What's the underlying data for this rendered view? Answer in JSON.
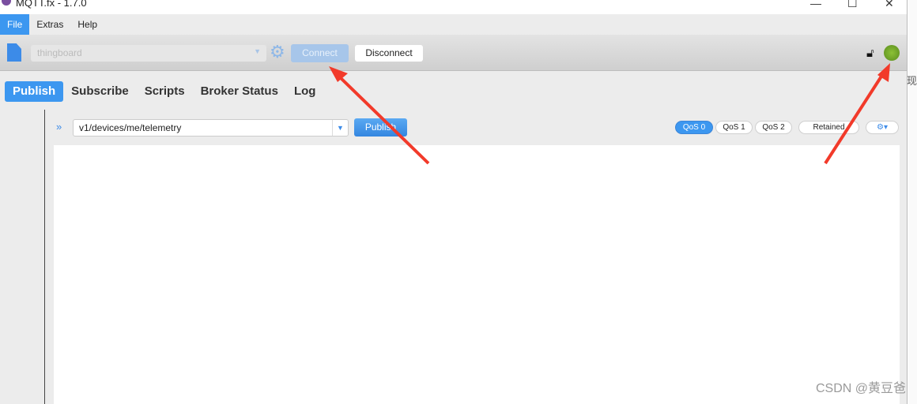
{
  "window": {
    "title": "MQTT.fx - 1.7.0",
    "controls": {
      "minimize": "—",
      "maximize": "☐",
      "close": "✕"
    }
  },
  "menu": [
    {
      "label": "File",
      "active": true
    },
    {
      "label": "Extras"
    },
    {
      "label": "Help"
    }
  ],
  "toolbar": {
    "profile": "thingboard",
    "connect_label": "Connect",
    "disconnect_label": "Disconnect",
    "lock_icon": "unlock-icon",
    "status_color": "#7ab02c"
  },
  "tabs": [
    {
      "label": "Publish",
      "active": true
    },
    {
      "label": "Subscribe"
    },
    {
      "label": "Scripts"
    },
    {
      "label": "Broker Status"
    },
    {
      "label": "Log"
    }
  ],
  "publish": {
    "topic": "v1/devices/me/telemetry",
    "publish_label": "Publish",
    "qos": [
      "QoS 0",
      "QoS 1",
      "QoS 2"
    ],
    "selected_qos": "QoS 0",
    "retained_label": "Retained",
    "payload": ""
  },
  "watermark": "CSDN @黄豆爸",
  "outside_text": "现",
  "accent": "#3c97f0"
}
